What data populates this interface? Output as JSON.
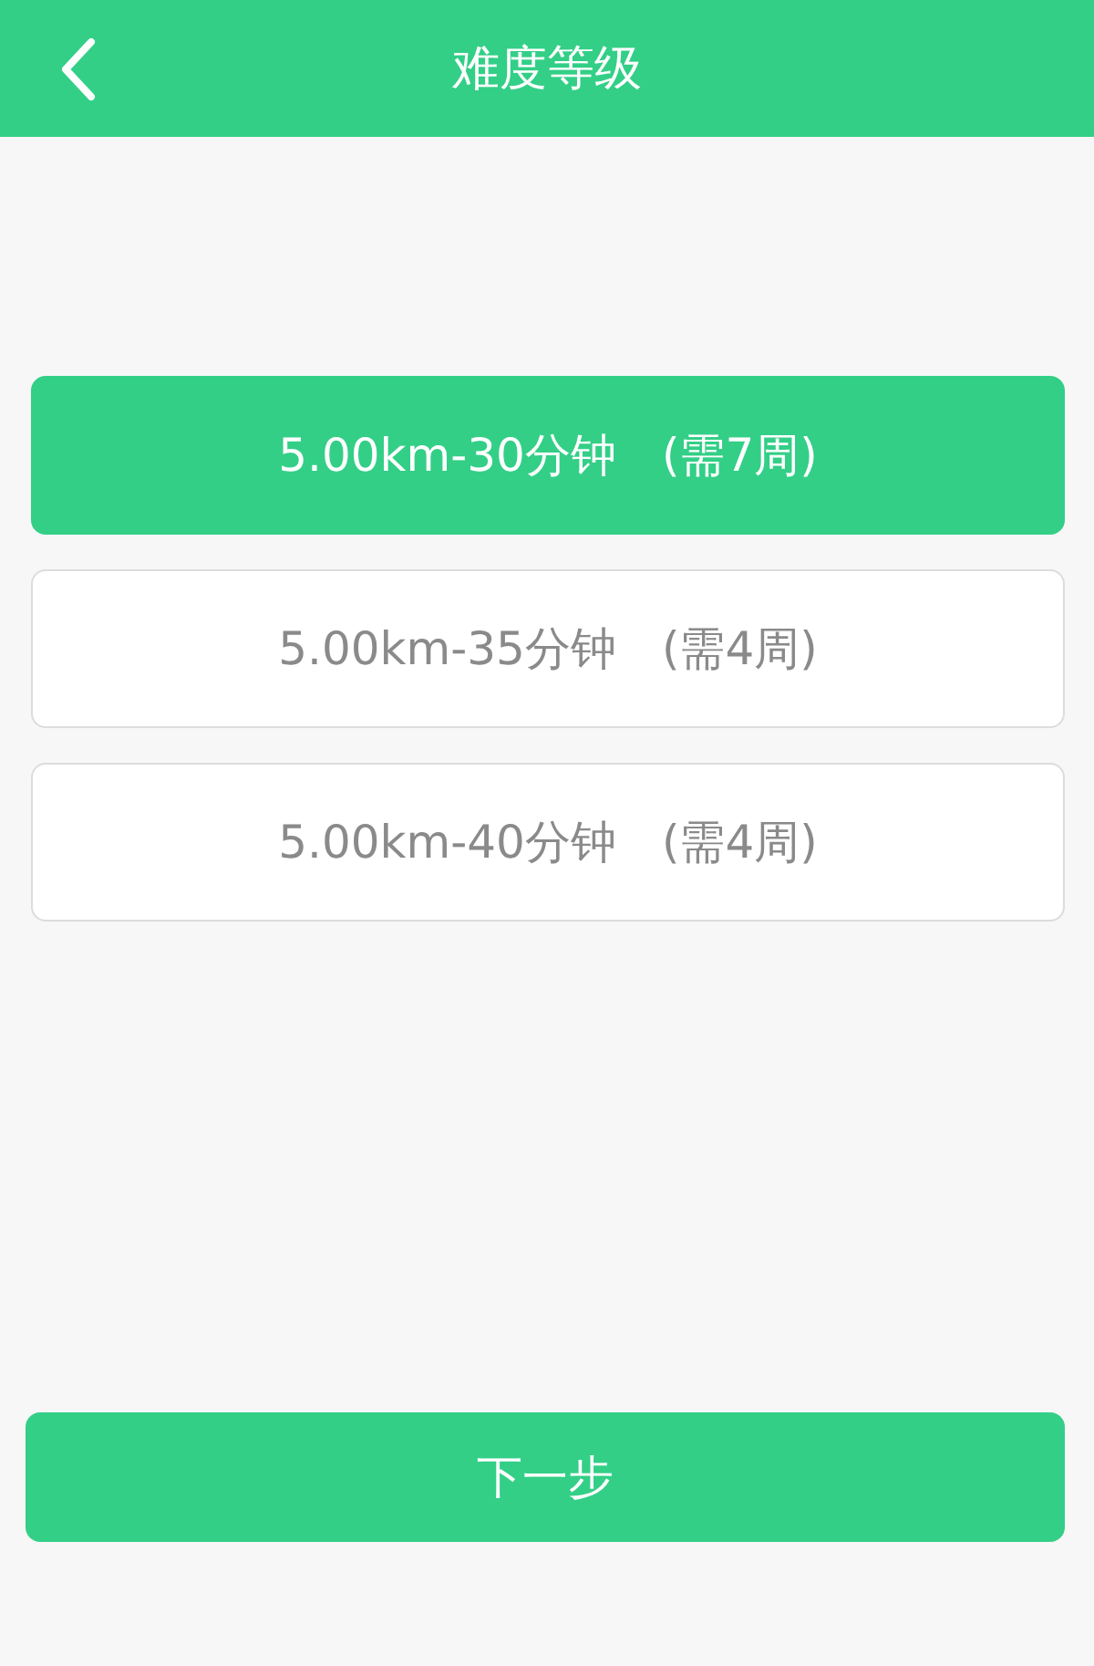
{
  "header": {
    "title": "难度等级"
  },
  "options": [
    {
      "label": "5.00km-30分钟　(需7周)",
      "selected": true
    },
    {
      "label": "5.00km-35分钟　(需4周)",
      "selected": false
    },
    {
      "label": "5.00km-40分钟　(需4周)",
      "selected": false
    }
  ],
  "next_button": "下一步"
}
